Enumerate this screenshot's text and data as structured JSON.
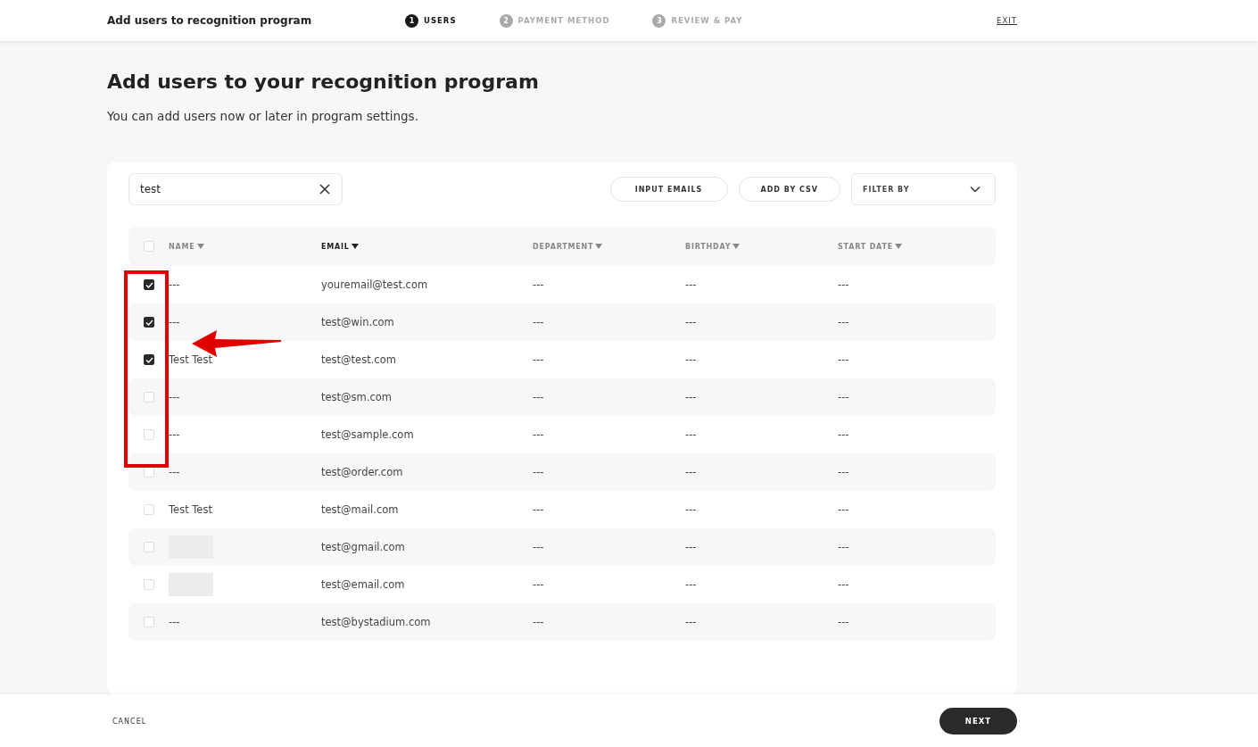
{
  "header": {
    "title": "Add users to recognition program",
    "steps": [
      {
        "number": "1",
        "label": "USERS",
        "selected": true
      },
      {
        "number": "2",
        "label": "PAYMENT METHOD",
        "selected": false
      },
      {
        "number": "3",
        "label": "REVIEW & PAY",
        "selected": false
      }
    ],
    "exit": "EXIT"
  },
  "page": {
    "heading": "Add users to your recognition program",
    "subheading": "You can add users now or later in program settings."
  },
  "search": {
    "value": "test"
  },
  "buttons": [
    "INPUT EMAILS",
    "ADD BY CSV"
  ],
  "filter": {
    "label": "FILTER BY"
  },
  "table": {
    "select_all": false,
    "columns": [
      {
        "label": "NAME",
        "selected": false
      },
      {
        "label": "EMAIL",
        "selected": true
      },
      {
        "label": "DEPARTMENT",
        "selected": false
      },
      {
        "label": "BIRTHDAY",
        "selected": false
      },
      {
        "label": "START DATE",
        "selected": false
      }
    ],
    "rows": [
      {
        "checked": true,
        "name": "---",
        "email": "youremail@test.com",
        "department": "---",
        "birthday": "---",
        "start_date": "---"
      },
      {
        "checked": true,
        "name": "---",
        "email": "test@win.com",
        "department": "---",
        "birthday": "---",
        "start_date": "---"
      },
      {
        "checked": true,
        "name": "Test Test",
        "email": "test@test.com",
        "department": "---",
        "birthday": "---",
        "start_date": "---"
      },
      {
        "checked": false,
        "name": "---",
        "email": "test@sm.com",
        "department": "---",
        "birthday": "---",
        "start_date": "---"
      },
      {
        "checked": false,
        "name": "---",
        "email": "test@sample.com",
        "department": "---",
        "birthday": "---",
        "start_date": "---"
      },
      {
        "checked": false,
        "name": "---",
        "email": "test@order.com",
        "department": "---",
        "birthday": "---",
        "start_date": "---"
      },
      {
        "checked": false,
        "name": "Test Test",
        "email": "test@mail.com",
        "department": "---",
        "birthday": "---",
        "start_date": "---"
      },
      {
        "checked": false,
        "redacted": true,
        "email": "test@gmail.com",
        "department": "---",
        "birthday": "---",
        "start_date": "---"
      },
      {
        "checked": false,
        "redacted": true,
        "email": "test@email.com",
        "department": "---",
        "birthday": "---",
        "start_date": "---"
      },
      {
        "checked": false,
        "name": "---",
        "email": "test@bystadium.com",
        "department": "---",
        "birthday": "---",
        "start_date": "---"
      }
    ]
  },
  "footer": {
    "cancel": "CANCEL",
    "next": "NEXT"
  }
}
